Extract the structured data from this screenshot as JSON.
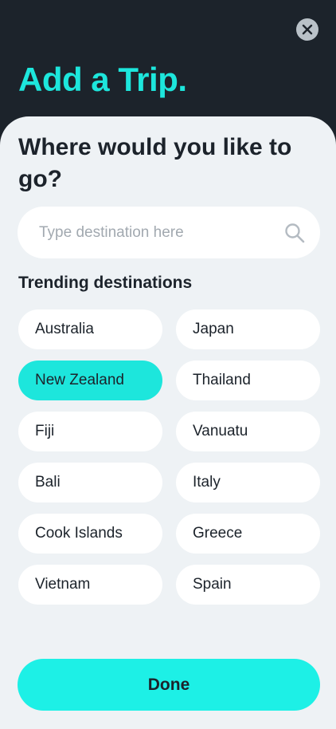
{
  "header": {
    "title": "Add a Trip.",
    "close_icon": "close-icon"
  },
  "main": {
    "question": "Where would you like to go?",
    "search": {
      "placeholder": "Type destination here",
      "value": "",
      "icon": "search-icon"
    },
    "trending_heading": "Trending destinations",
    "destinations": [
      {
        "label": "Australia",
        "selected": false
      },
      {
        "label": "Japan",
        "selected": false
      },
      {
        "label": "New Zealand",
        "selected": true
      },
      {
        "label": "Thailand",
        "selected": false
      },
      {
        "label": "Fiji",
        "selected": false
      },
      {
        "label": "Vanuatu",
        "selected": false
      },
      {
        "label": "Bali",
        "selected": false
      },
      {
        "label": "Italy",
        "selected": false
      },
      {
        "label": "Cook Islands",
        "selected": false
      },
      {
        "label": "Greece",
        "selected": false
      },
      {
        "label": "Vietnam",
        "selected": false
      },
      {
        "label": "Spain",
        "selected": false
      }
    ],
    "done_label": "Done"
  },
  "colors": {
    "accent": "#1de6dc",
    "dark_background": "#1c232b",
    "sheet_background": "#eef2f5",
    "pill_background": "#ffffff"
  }
}
